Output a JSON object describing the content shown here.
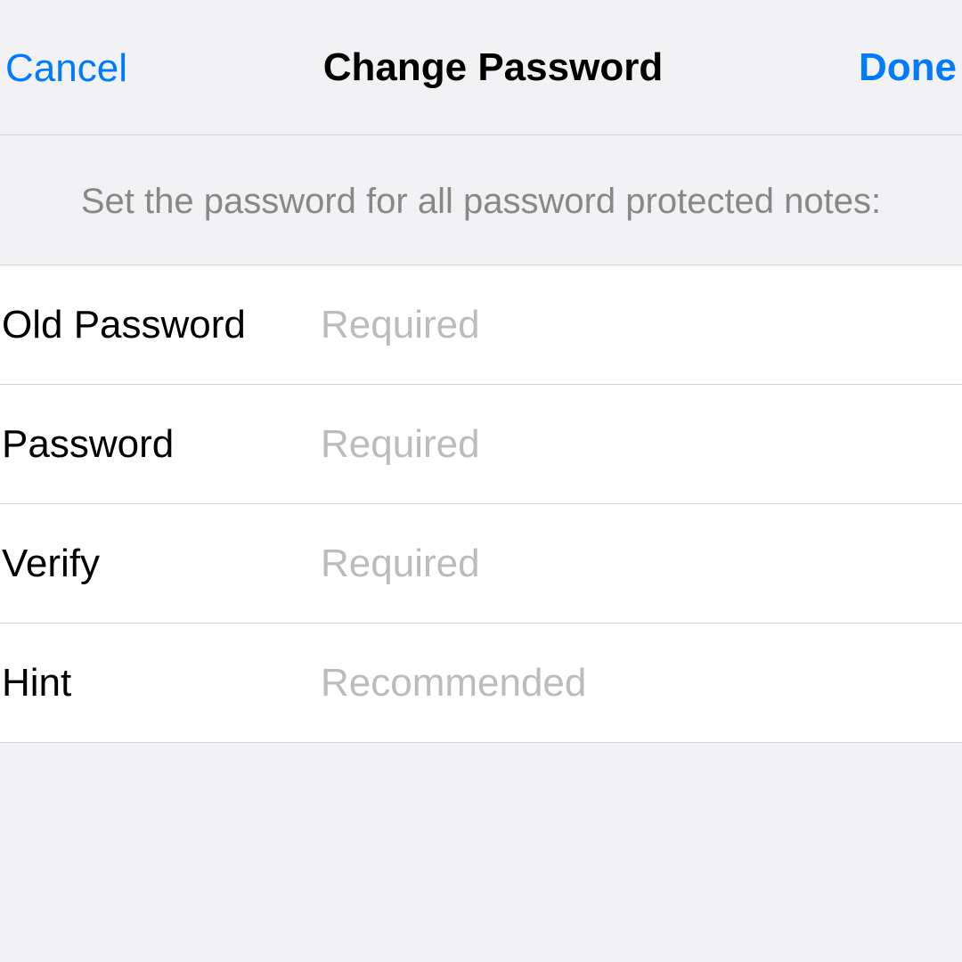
{
  "header": {
    "cancel": "Cancel",
    "title": "Change Password",
    "done": "Done"
  },
  "section_description": "Set the password for all password protected notes:",
  "fields": {
    "old_password": {
      "label": "Old Password",
      "placeholder": "Required"
    },
    "password": {
      "label": "Password",
      "placeholder": "Required"
    },
    "verify": {
      "label": "Verify",
      "placeholder": "Required"
    },
    "hint": {
      "label": "Hint",
      "placeholder": "Recommended"
    }
  }
}
